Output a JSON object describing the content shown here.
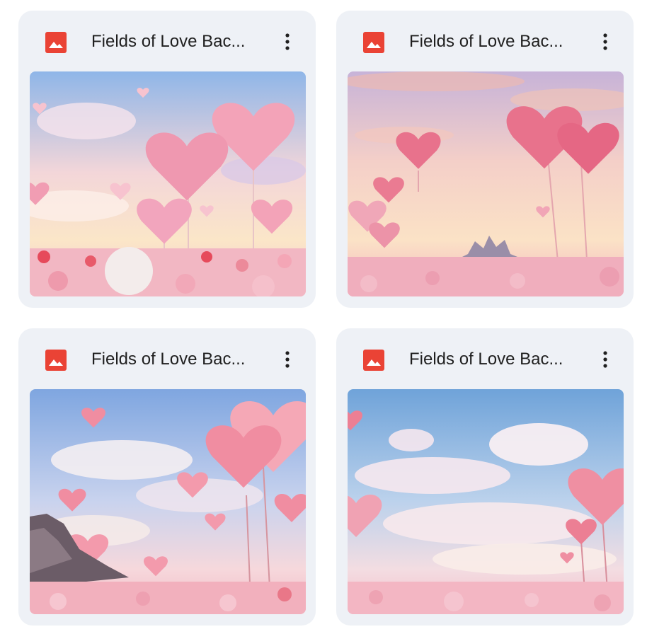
{
  "files": [
    {
      "title": "Fields of Love Bac...",
      "icon": "image-file-icon",
      "scene": "sunset-fluffy-hearts"
    },
    {
      "title": "Fields of Love Bac...",
      "icon": "image-file-icon",
      "scene": "dusk-heart-trees-castle"
    },
    {
      "title": "Fields of Love Bac...",
      "icon": "image-file-icon",
      "scene": "blue-sky-heart-balloons-cliff"
    },
    {
      "title": "Fields of Love Bac...",
      "icon": "image-file-icon",
      "scene": "clouds-heart-balloons-meadow"
    }
  ],
  "colors": {
    "card_bg": "#eef1f6",
    "icon_red": "#ea4335",
    "title_text": "#1f1f1f"
  },
  "more_icon": "more-vert-icon"
}
